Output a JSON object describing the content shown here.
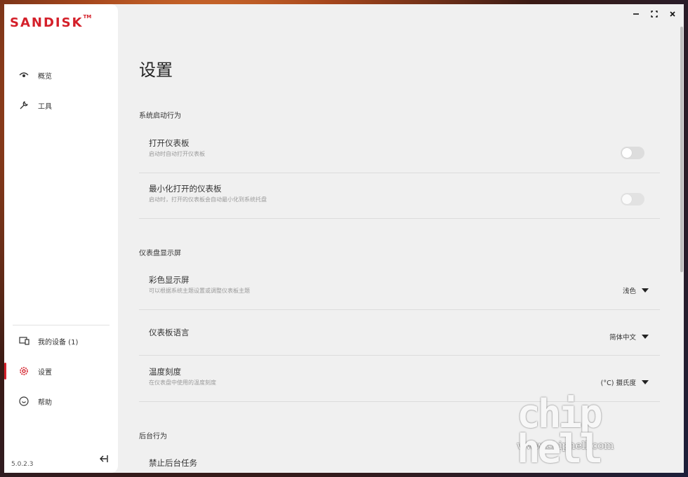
{
  "brand": {
    "logo": "SANDISK",
    "trademark": "TM"
  },
  "window_controls": {
    "minimize": "minimize-icon",
    "maximize": "maximize-icon",
    "close": "close-icon"
  },
  "sidebar": {
    "items": [
      {
        "label": "概览",
        "icon": "eye-icon"
      },
      {
        "label": "工具",
        "icon": "wrench-icon"
      }
    ],
    "bottom_items": [
      {
        "label": "我的设备 (1)",
        "icon": "devices-icon"
      },
      {
        "label": "设置",
        "icon": "gear-icon",
        "active": true
      },
      {
        "label": "帮助",
        "icon": "help-icon"
      }
    ],
    "version": "5.0.2.3",
    "collapse_icon": "collapse-left-icon"
  },
  "page": {
    "title": "设置",
    "sections": [
      {
        "title": "系统启动行为",
        "rows": [
          {
            "title": "打开仪表板",
            "desc": "启动时自动打开仪表板",
            "toggle": false
          },
          {
            "title": "最小化打开的仪表板",
            "desc": "启动时，打开的仪表板会自动最小化到系统托盘",
            "toggle": false
          }
        ]
      },
      {
        "title": "仪表盘显示屏",
        "rows": [
          {
            "title": "彩色显示屏",
            "desc": "可以根据系统主题设置或调整仪表板主题",
            "value": "浅色"
          },
          {
            "title": "仪表板语言",
            "desc": "",
            "value": "简体中文"
          },
          {
            "title": "温度刻度",
            "desc": "在仪表盘中使用的温度刻度",
            "value": "(°C) 摄氏度"
          }
        ]
      },
      {
        "title": "后台行为",
        "rows": [
          {
            "title": "禁止后台任务",
            "desc": ""
          }
        ]
      }
    ]
  },
  "watermark": {
    "url": "www.chiphell.com",
    "logo": "chip hell"
  },
  "colors": {
    "accent": "#d4202a",
    "background": "#f0f0f0",
    "sidebar": "#ffffff"
  }
}
